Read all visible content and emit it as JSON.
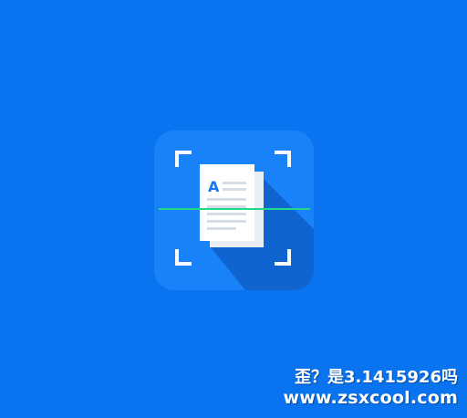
{
  "app_icon": {
    "name": "scanner-app-icon",
    "document_glyph": "A",
    "colors": {
      "background": "#0a73ef",
      "tile": "#1a82f8",
      "shadow": "#0e5fc9",
      "paper": "#ffffff",
      "paper_back": "#e9eef5",
      "text_lines": "#d7dde6",
      "glyph": "#1877f2",
      "scan_line": "#21d88a",
      "corners": "#ffffff"
    }
  },
  "watermark": {
    "line1": "歪？是3.1415926吗",
    "line2": "www.zsxcool.com"
  }
}
